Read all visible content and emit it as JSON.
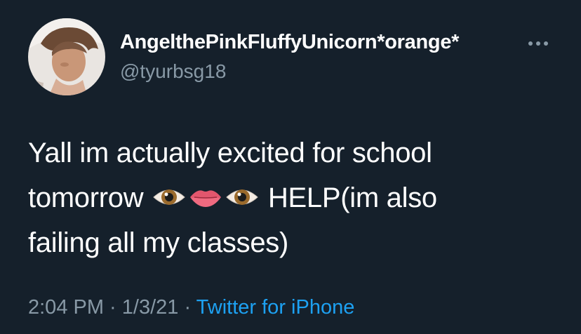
{
  "tweet": {
    "display_name": "AngelthePinkFluffyUnicorn*orange*",
    "handle": "@tyurbsg18",
    "text_line1": "Yall im actually excited for school",
    "text_line2_start": "tomorrow",
    "text_line2_end": " HELP(im also",
    "text_line3": "failing all my classes)",
    "emojis": [
      "eye",
      "mouth",
      "eye"
    ],
    "time": "2:04 PM",
    "separator": " · ",
    "date": "1/3/21",
    "source": "Twitter for iPhone"
  },
  "colors": {
    "background": "#15202b",
    "primary_text": "#ffffff",
    "secondary_text": "#8899a6",
    "link": "#1da1f2"
  },
  "icons": {
    "more": "more-horizontal-icon"
  }
}
